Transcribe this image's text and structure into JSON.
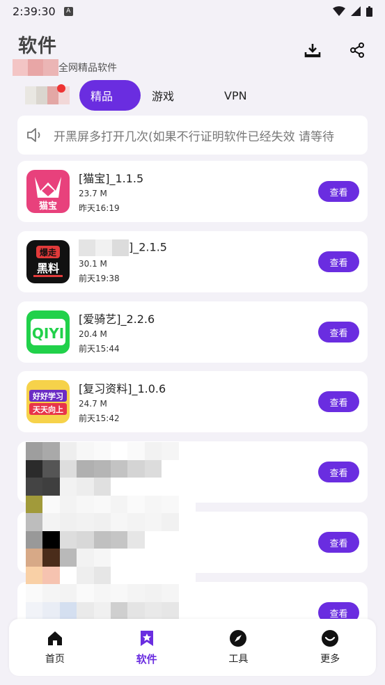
{
  "status": {
    "time": "2:39:30",
    "notif": "A"
  },
  "header": {
    "title": "软件",
    "subtitle": "全网精品软件"
  },
  "tabs": [
    {
      "label": "精品",
      "active": true
    },
    {
      "label": "游戏",
      "active": false
    },
    {
      "label": "VPN",
      "active": false
    }
  ],
  "notice": {
    "text": "开黑屏多打开几次(如果不行证明软件已经失效 请等待"
  },
  "apps": [
    {
      "name": "[猫宝]_1.1.5",
      "size": "23.7 M",
      "time": "昨天16:19",
      "button": "查看"
    },
    {
      "name": "]_2.1.5",
      "size": "30.1 M",
      "time": "前天19:38",
      "button": "查看"
    },
    {
      "name": "[爱骑艺]_2.2.6",
      "size": "20.4 M",
      "time": "前天15:44",
      "button": "查看"
    },
    {
      "name": "[复习资料]_1.0.6",
      "size": "24.7 M",
      "time": "前天15:42",
      "button": "查看"
    },
    {
      "name": "",
      "size": "",
      "time": "",
      "button": "查看"
    },
    {
      "name": "",
      "size": "",
      "time": "",
      "button": "查看"
    },
    {
      "name": "",
      "size": "",
      "time": "",
      "button": "查看"
    }
  ],
  "icons": {
    "app1_text": "猫宝",
    "app2_text_top": "爆走",
    "app2_text_bottom": "黑料",
    "app3_text": "QIYI",
    "app4_text_top": "好好学习",
    "app4_text_bottom": "天天向上"
  },
  "nav": [
    {
      "label": "首页",
      "icon": "home-icon"
    },
    {
      "label": "软件",
      "icon": "star-bookmark-icon",
      "active": true
    },
    {
      "label": "工具",
      "icon": "compass-icon"
    },
    {
      "label": "更多",
      "icon": "smile-icon"
    }
  ],
  "colors": {
    "accent": "#6a2de0",
    "background": "#f3f1f7"
  }
}
